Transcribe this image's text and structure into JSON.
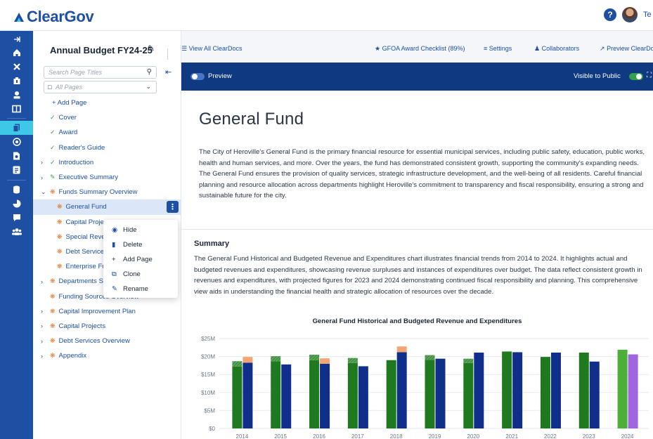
{
  "app": {
    "logo": "ClearGov",
    "user_initial": "Te"
  },
  "doc": {
    "title": "Annual Budget FY24-25"
  },
  "sidebar": {
    "search_placeholder": "Search Page Titles",
    "pages_filter": "All Pages",
    "add_page": "+ Add Page",
    "items": [
      {
        "label": "Cover",
        "level": 0,
        "state": "done",
        "caret": false
      },
      {
        "label": "Award",
        "level": 0,
        "state": "done",
        "caret": false
      },
      {
        "label": "Reader's Guide",
        "level": 0,
        "state": "done",
        "caret": false
      },
      {
        "label": "Introduction",
        "level": 0,
        "state": "done",
        "caret": true,
        "open": false
      },
      {
        "label": "Executive Summary",
        "level": 0,
        "state": "edit",
        "caret": true,
        "open": false
      },
      {
        "label": "Funds Summary Overview",
        "level": 0,
        "state": "progress",
        "caret": true,
        "open": true
      },
      {
        "label": "General Fund",
        "level": 1,
        "state": "progress",
        "caret": false,
        "selected": true
      },
      {
        "label": "Capital Projects",
        "level": 1,
        "state": "progress",
        "caret": false
      },
      {
        "label": "Special Revenue",
        "level": 1,
        "state": "progress",
        "caret": false
      },
      {
        "label": "Debt Service",
        "level": 1,
        "state": "progress",
        "caret": false
      },
      {
        "label": "Enterprise Funds",
        "level": 1,
        "state": "progress",
        "caret": false
      },
      {
        "label": "Departments Summary",
        "level": 0,
        "state": "progress",
        "caret": true,
        "open": false
      },
      {
        "label": "Funding Sources Overview",
        "level": 0,
        "state": "progress",
        "caret": false
      },
      {
        "label": "Capital Improvement Plan",
        "level": 0,
        "state": "progress",
        "caret": true,
        "open": false
      },
      {
        "label": "Capital Projects",
        "level": 0,
        "state": "progress",
        "caret": true,
        "open": false
      },
      {
        "label": "Debt Services Overview",
        "level": 0,
        "state": "progress",
        "caret": true,
        "open": false
      },
      {
        "label": "Appendix",
        "level": 0,
        "state": "progress",
        "caret": true,
        "open": false
      }
    ]
  },
  "context_menu": {
    "items": [
      {
        "label": "Hide",
        "icon": "eye-icon"
      },
      {
        "label": "Delete",
        "icon": "trash-icon"
      },
      {
        "label": "Add Page",
        "icon": "plus-icon"
      },
      {
        "label": "Clone",
        "icon": "clone-icon"
      },
      {
        "label": "Rename",
        "icon": "rename-icon"
      }
    ]
  },
  "toolbar": {
    "view_all": "View All ClearDocs",
    "gfoa": "GFOA Award Checklist (89%)",
    "settings": "Settings",
    "collaborators": "Collaborators",
    "preview_cleardoc": "Preview ClearDoc"
  },
  "preview_bar": {
    "preview_label": "Preview",
    "visible_label": "Visible to Public"
  },
  "page": {
    "heading": "General Fund",
    "intro": "The City of Heroville's General Fund is the primary financial resource for essential municipal services, including public safety, education, public works, health and human services, and more. Over the years, the fund has demonstrated consistent growth, supporting the community's expanding needs. The General Fund ensures the provision of quality services, strategic infrastructure development, and the well-being of all residents. Careful financial planning and resource allocation across departments highlight Heroville's commitment to transparency and fiscal responsibility, ensuring a strong and sustainable future for the city.",
    "summary_heading": "Summary",
    "summary": "The General Fund Historical and Budgeted Revenue and Expenditures chart illustrates financial trends from 2014 to 2024. It highlights actual and budgeted revenues and expenditures, showcasing revenue surpluses and instances of expenditures over budget. The data reflect consistent growth in revenues and expenditures, with projected figures for 2023 and 2024 demonstrating continued fiscal responsibility and planning. This comprehensive view aids in understanding the financial health and strategic allocation of resources over the decade."
  },
  "chart_data": {
    "type": "bar",
    "title": "General Fund Historical and Budgeted Revenue and Expenditures",
    "categories": [
      "2014",
      "2015",
      "2016",
      "2017",
      "2018",
      "2019",
      "2020",
      "2021",
      "2022",
      "2023",
      "2024"
    ],
    "ylim": [
      0,
      25
    ],
    "yticks": [
      "$0",
      "$5M",
      "$10M",
      "$15M",
      "$20M",
      "$25M"
    ],
    "series": [
      {
        "color": "#1f7a1f",
        "values": [
          17.2,
          18.7,
          19.0,
          18.2,
          19.0,
          19.1,
          18.2,
          21.4,
          19.9,
          21.1,
          21.9
        ]
      },
      {
        "color": "#0f2f8a",
        "values": [
          18.3,
          17.8,
          18.0,
          17.3,
          21.2,
          19.4,
          21.1,
          21.2,
          21.1,
          18.6,
          20.6
        ]
      }
    ],
    "surplus": [
      1.5,
      1.4,
      1.5,
      1.4,
      0.0,
      1.3,
      1.2,
      0.0,
      0.0,
      0.0,
      0.0
    ],
    "over_budget": [
      1.6,
      0.0,
      1.5,
      0.0,
      1.6,
      0.0,
      0.0,
      0.0,
      0.0,
      0.0,
      0.0
    ],
    "projected_colors": [
      "#4caf3a",
      "#a066e0"
    ],
    "colors": {
      "surplus": "#5aa65a",
      "over_budget": "#f4a574"
    }
  }
}
